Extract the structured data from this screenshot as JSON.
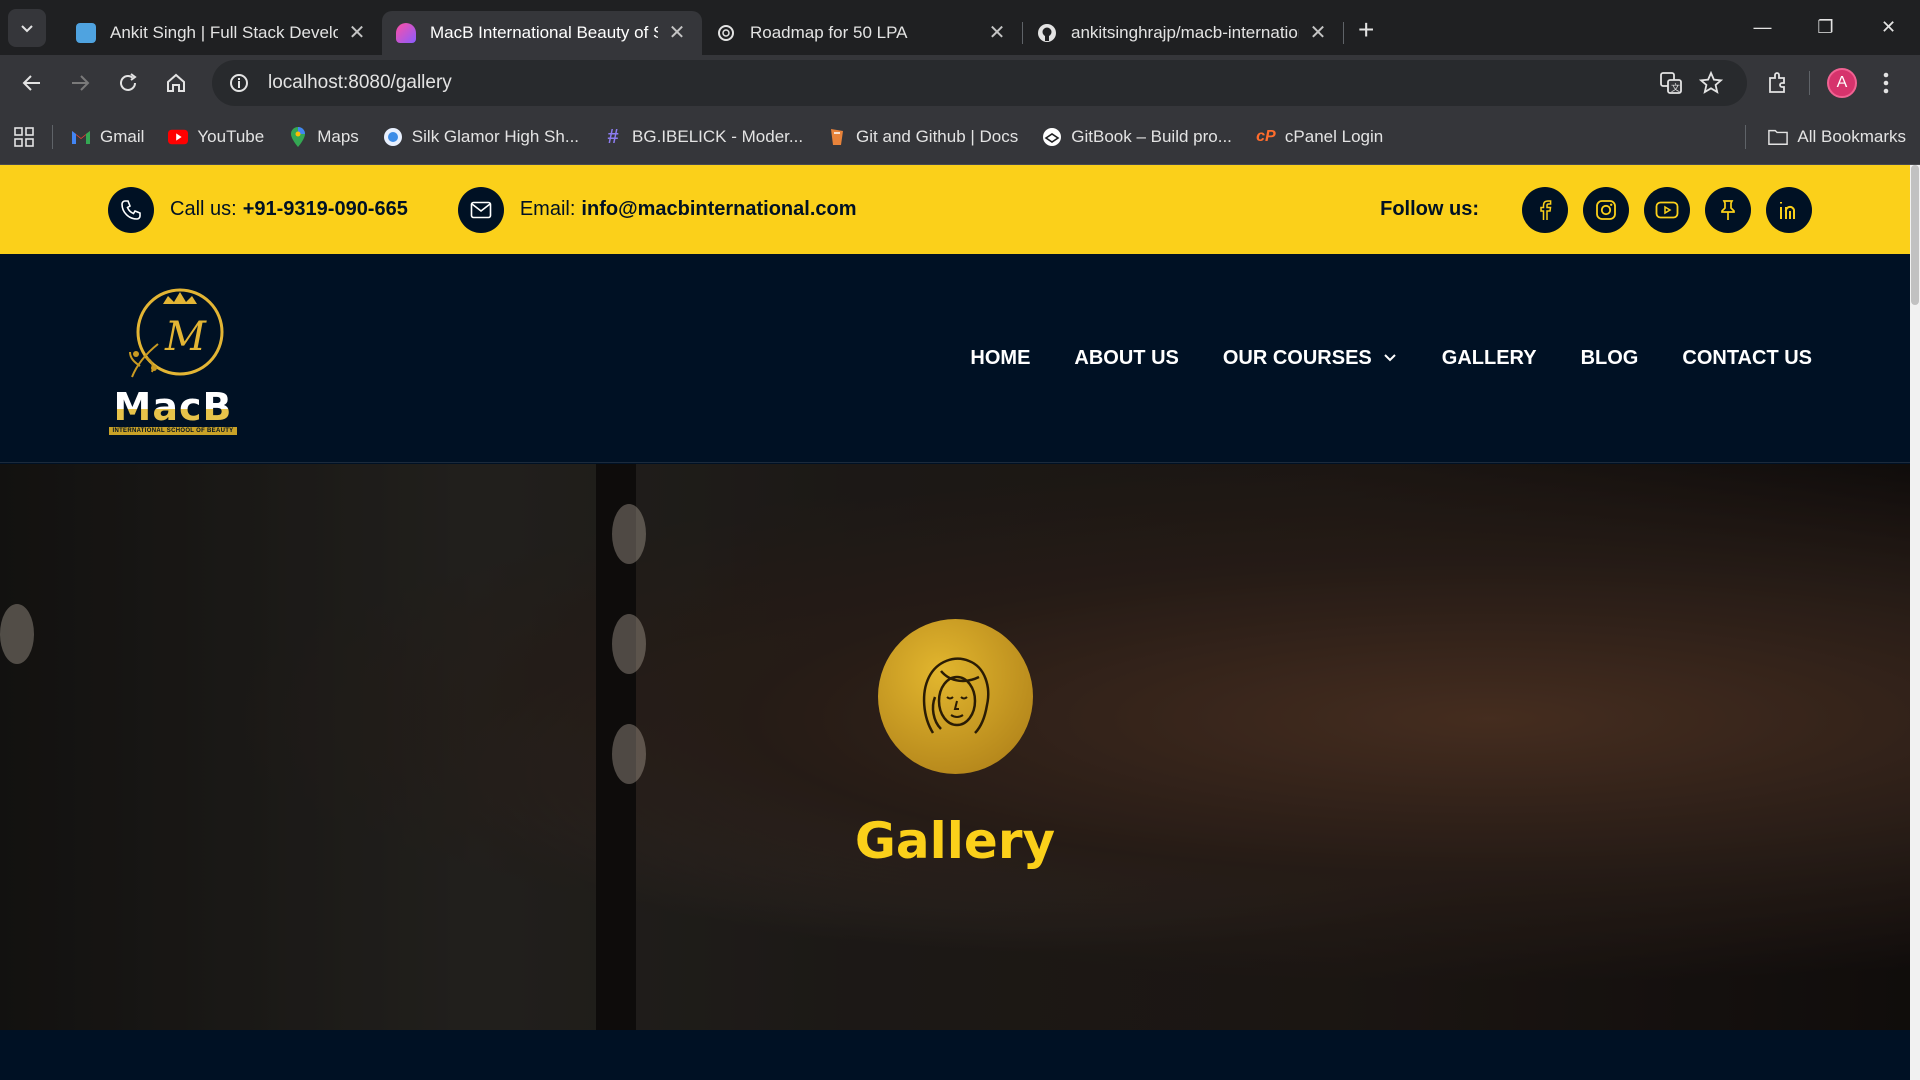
{
  "browser": {
    "tabs": [
      {
        "title": "Ankit Singh | Full Stack Developer",
        "favicon": "bag-icon",
        "active": false
      },
      {
        "title": "MacB International Beauty of Schools",
        "favicon": "macb-icon",
        "active": true
      },
      {
        "title": "Roadmap for 50 LPA",
        "favicon": "openai-icon",
        "active": false
      },
      {
        "title": "ankitsinghrajp/macb-international",
        "favicon": "github-icon",
        "active": false
      }
    ],
    "url": "localhost:8080/gallery",
    "profile_initial": "A",
    "bookmarks": [
      {
        "label": "Gmail",
        "icon": "gmail-icon"
      },
      {
        "label": "YouTube",
        "icon": "youtube-icon"
      },
      {
        "label": "Maps",
        "icon": "maps-icon"
      },
      {
        "label": "Silk Glamor High Sh...",
        "icon": "globe-icon"
      },
      {
        "label": "BG.IBELICK - Moder...",
        "icon": "hash-icon"
      },
      {
        "label": "Git and Github | Docs",
        "icon": "docs-icon"
      },
      {
        "label": "GitBook – Build pro...",
        "icon": "gitbook-icon"
      },
      {
        "label": "cPanel Login",
        "icon": "cpanel-icon"
      }
    ],
    "all_bookmarks": "All Bookmarks"
  },
  "topbar": {
    "call_label": "Call us:",
    "call_value": "+91-9319-090-665",
    "email_label": "Email:",
    "email_value": "info@macbinternational.com",
    "follow_label": "Follow us:",
    "socials": [
      "facebook-icon",
      "instagram-icon",
      "youtube-icon",
      "pin-icon",
      "linkedin-icon"
    ]
  },
  "header": {
    "logo_text": "MacB",
    "logo_sub": "INTERNATIONAL SCHOOL OF BEAUTY",
    "nav": [
      "HOME",
      "ABOUT US",
      "OUR COURSES",
      "GALLERY",
      "BLOG",
      "CONTACT US"
    ]
  },
  "hero": {
    "title": "Gallery",
    "badge_icon": "woman-face-icon"
  },
  "colors": {
    "accent": "#fbd01a",
    "navy": "#001124",
    "badge_gold": "#c99a22"
  }
}
